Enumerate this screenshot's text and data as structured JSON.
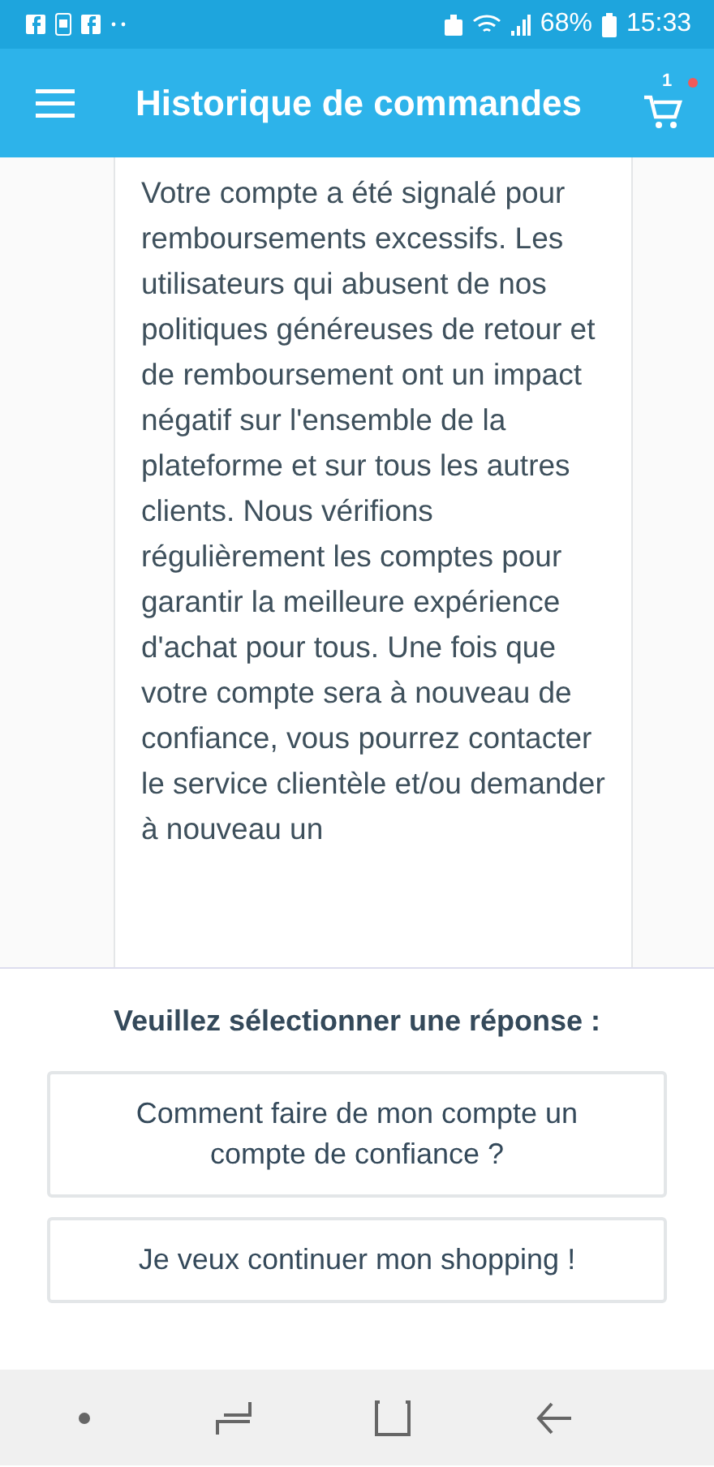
{
  "status_bar": {
    "battery": "68%",
    "time": "15:33"
  },
  "header": {
    "title": "Historique de commandes",
    "cart_count": "1"
  },
  "message": {
    "text": "Votre compte a été signalé pour remboursements excessifs. Les utilisateurs qui abusent de nos politiques généreuses de retour et de remboursement ont un impact négatif sur l'ensemble de la plateforme et sur tous les autres clients. Nous vérifions régulièrement les comptes pour garantir la meilleure expérience d'achat pour tous. Une fois que votre compte sera à nouveau de confiance, vous pourrez contacter le service clientèle et/ou demander à nouveau un"
  },
  "response_sheet": {
    "prompt": "Veuillez sélectionner une réponse :",
    "options": [
      {
        "label": "Comment faire de mon compte un compte de confiance ?"
      },
      {
        "label": "Je veux continuer mon shopping !"
      }
    ]
  }
}
